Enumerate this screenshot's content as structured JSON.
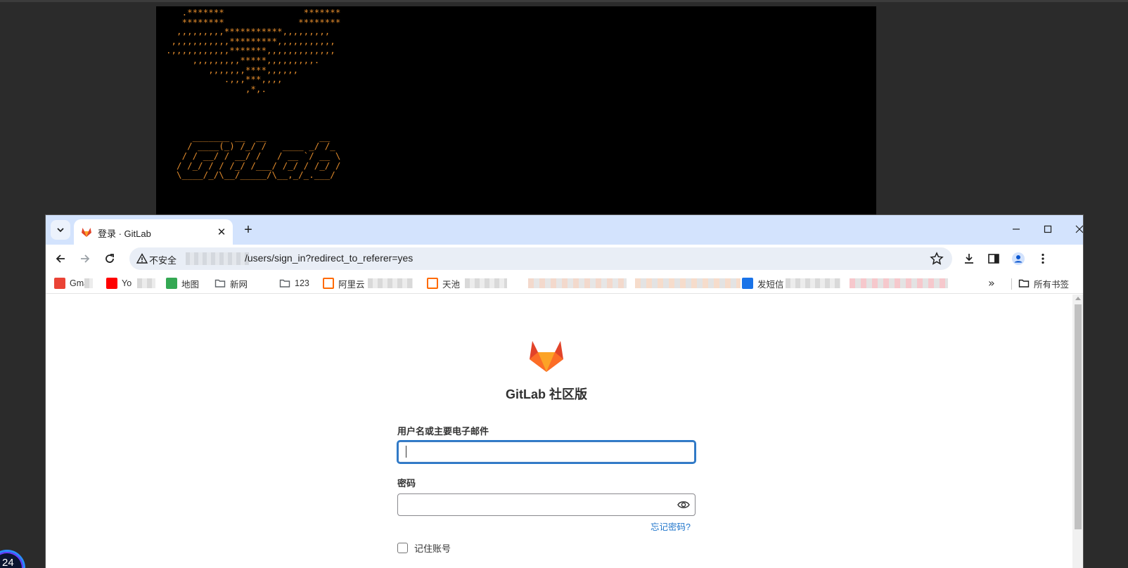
{
  "terminal": {
    "ascii_art": "   .*******               *******\n   ********              ********\n  ,,,,,,,,,***********,,,,,,,,,\n ,,,,,,,,,,,*********,,,,,,,,,,,\n.,,,,,,,,,,,*******,,,,,,,,,,,,,\n     ,,,,,,,,,*****,,,,,,,,,.\n        ,,,,,,,****,,,,,,\n           .,,,***,,,,\n               ,*,.\n\n\n\n\n     _______ __  __          __\n    / ____(_) /_/ /   ____ _/ /_\n   / / __/ / __/ /   / __ `/ __ \\\n  / /_/ / / /_/ /___/ /_/ / /_/ /\n  \\____/_/\\__/_____/\\__,_/_.___/"
  },
  "desktop": {
    "badge_number": "24"
  },
  "browser": {
    "tab": {
      "title": "登录 · GitLab",
      "close_glyph": "✕"
    },
    "new_tab_glyph": "+",
    "omnibox": {
      "security_label": "不安全",
      "url_path": "/users/sign_in?redirect_to_referer=yes"
    },
    "bookmarks": {
      "items": [
        {
          "label": "Gmail",
          "color": "#ea4335"
        },
        {
          "label": "Yo",
          "color": "#ff0000"
        },
        {
          "label": "地图",
          "color": "#34a853"
        },
        {
          "label": "新网",
          "color": "#5f6368"
        },
        {
          "label": "123",
          "color": "#5f6368"
        },
        {
          "label": "阿里云",
          "color": "#ff6a00"
        },
        {
          "label": "天池",
          "color": "#ff6a00"
        },
        {
          "label": "发短信",
          "color": "#1a73e8"
        }
      ],
      "more_glyph": "»",
      "all_bookmarks_label": "所有书签"
    }
  },
  "page": {
    "brand_title": "GitLab 社区版",
    "username_label": "用户名或主要电子邮件",
    "username_value": "",
    "password_label": "密码",
    "password_value": "",
    "forgot_password": "忘记密码?",
    "remember_me": "记住账号"
  },
  "colors": {
    "logo_orange": "#e24329",
    "logo_light": "#fc6d26",
    "logo_yellow": "#fca326",
    "link_blue": "#1f75cb",
    "tab_bar": "#d3e3fd"
  }
}
